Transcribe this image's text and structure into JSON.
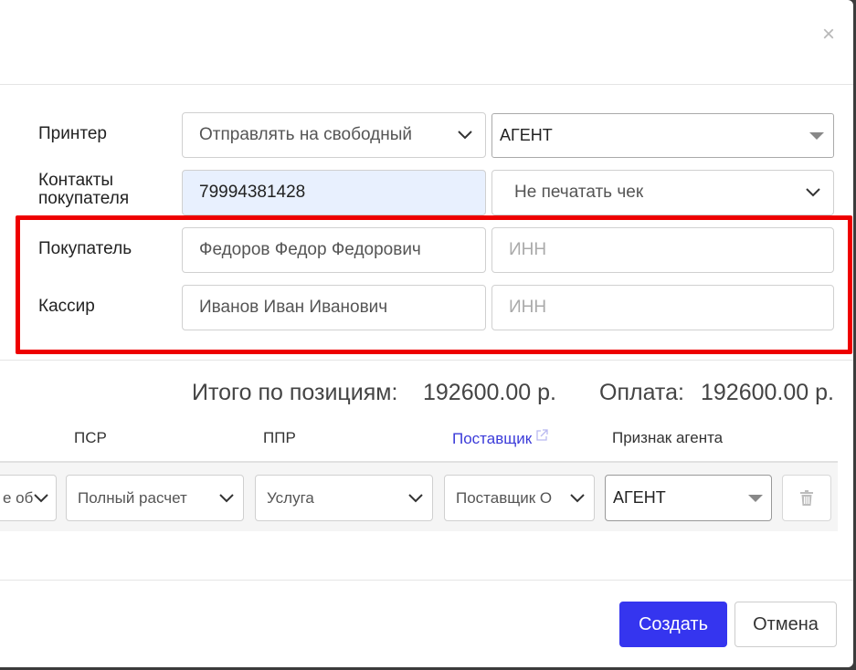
{
  "dialog": {
    "close_symbol": "×"
  },
  "form": {
    "printer": {
      "label": "Принтер",
      "value": "Отправлять на свободный",
      "agent_value": "АГЕНТ"
    },
    "contacts": {
      "label_line1": "Контакты",
      "label_line2": "покупателя",
      "value": "79994381428",
      "receipt_value": "Не печатать чек"
    },
    "buyer": {
      "label": "Покупатель",
      "name_value": "Федоров Федор Федорович",
      "inn_placeholder": "ИНН"
    },
    "cashier": {
      "label": "Кассир",
      "name_value": "Иванов Иван Иванович",
      "inn_placeholder": "ИНН"
    }
  },
  "totals": {
    "positions_label": "Итого по позициям:",
    "positions_value": "192600.00 р.",
    "payment_label": "Оплата:",
    "payment_value": "192600.00 р."
  },
  "table": {
    "headers": {
      "psr": "ПСР",
      "ppr": "ППР",
      "supplier": "Поставщик",
      "agent": "Признак агента"
    },
    "row": {
      "cut_value": "е об",
      "psr": "Полный расчет",
      "ppr": "Услуга",
      "supplier": "Поставщик О",
      "agent": "АГЕНТ"
    }
  },
  "actions": {
    "create": "Создать",
    "cancel": "Отмена"
  },
  "colors": {
    "primary": "#3535ef",
    "highlight": "#ee0000",
    "link": "#3b3bd9",
    "filled_bg": "#e8f0fe"
  }
}
